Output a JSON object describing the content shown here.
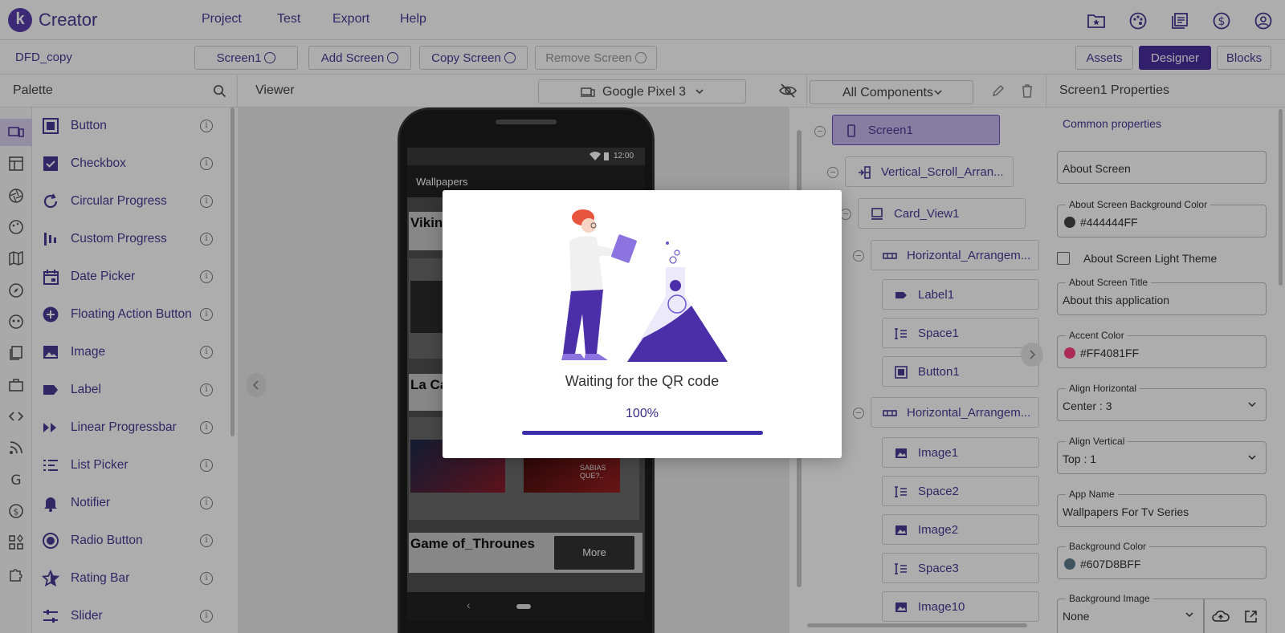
{
  "app": {
    "logo_letter": "k",
    "title": "Creator"
  },
  "menu": [
    "Project",
    "Test",
    "Export",
    "Help"
  ],
  "top_icons": [
    "folder-star-icon",
    "palette-icon",
    "library-icon",
    "dollar-icon",
    "account-icon"
  ],
  "toolbar": {
    "project_name": "DFD_copy",
    "screen_select": "Screen1",
    "add_screen": "Add Screen",
    "copy_screen": "Copy Screen",
    "remove_screen": "Remove Screen",
    "assets": "Assets",
    "designer": "Designer",
    "blocks": "Blocks"
  },
  "palette": {
    "title": "Palette",
    "items": [
      {
        "label": "Button",
        "icon": "button-icon"
      },
      {
        "label": "Checkbox",
        "icon": "checkbox-icon"
      },
      {
        "label": "Circular Progress",
        "icon": "circular-progress-icon"
      },
      {
        "label": "Custom Progress",
        "icon": "custom-progress-icon"
      },
      {
        "label": "Date Picker",
        "icon": "date-picker-icon"
      },
      {
        "label": "Floating Action Button",
        "icon": "fab-icon"
      },
      {
        "label": "Image",
        "icon": "image-icon"
      },
      {
        "label": "Label",
        "icon": "label-icon"
      },
      {
        "label": "Linear Progressbar",
        "icon": "linear-progress-icon"
      },
      {
        "label": "List Picker",
        "icon": "list-picker-icon"
      },
      {
        "label": "Notifier",
        "icon": "bell-icon"
      },
      {
        "label": "Radio Button",
        "icon": "radio-icon"
      },
      {
        "label": "Rating Bar",
        "icon": "star-icon"
      },
      {
        "label": "Slider",
        "icon": "slider-icon"
      }
    ],
    "info_glyph": "i"
  },
  "viewer": {
    "title": "Viewer",
    "device": "Google Pixel 3",
    "phone": {
      "time": "12:00",
      "app_title": "Wallpapers",
      "card1_title": "Vikin",
      "card2_title": "La Ca",
      "card3_title": "Game of_Throunes",
      "more_button": "More",
      "thumb_text": "SABIAS QUE?..",
      "nav_back": "‹"
    }
  },
  "components": {
    "select": "All Components",
    "nodes": [
      {
        "label": "Screen1",
        "icon": "phone-icon"
      },
      {
        "label": "Vertical_Scroll_Arran...",
        "icon": "vertical-scroll-icon"
      },
      {
        "label": "Card_View1",
        "icon": "card-icon"
      },
      {
        "label": "Horizontal_Arrangem...",
        "icon": "horizontal-arrangement-icon"
      },
      {
        "label": "Label1",
        "icon": "label-icon"
      },
      {
        "label": "Space1",
        "icon": "space-icon"
      },
      {
        "label": "Button1",
        "icon": "button-icon"
      },
      {
        "label": "Horizontal_Arrangem...",
        "icon": "horizontal-arrangement-icon"
      },
      {
        "label": "Image1",
        "icon": "image-icon"
      },
      {
        "label": "Space2",
        "icon": "space-icon"
      },
      {
        "label": "Image2",
        "icon": "image-icon"
      },
      {
        "label": "Space3",
        "icon": "space-icon"
      },
      {
        "label": "Image10",
        "icon": "image-icon"
      }
    ]
  },
  "properties": {
    "title": "Screen1 Properties",
    "section": "Common properties",
    "about_screen_placeholder": "About Screen",
    "bg_color_label": "About Screen Background Color",
    "bg_color_value": "#444444FF",
    "light_theme_label": "About Screen Light Theme",
    "title_label": "About Screen Title",
    "title_value": "About this application",
    "accent_label": "Accent Color",
    "accent_value": "#FF4081FF",
    "align_h_label": "Align Horizontal",
    "align_h_value": "Center : 3",
    "align_v_label": "Align Vertical",
    "align_v_value": "Top : 1",
    "app_name_label": "App Name",
    "app_name_value": "Wallpapers For Tv Series",
    "background_color_label": "Background Color",
    "background_color_value": "#607D8BFF",
    "background_image_label": "Background Image",
    "background_image_value": "None"
  },
  "modal": {
    "message": "Waiting for the QR code",
    "percent_text": "100%",
    "progress": 1.0
  },
  "colors": {
    "accent": "#4a2fa0",
    "swatch_about": "#444444",
    "swatch_accent": "#FF4081",
    "swatch_bg": "#607D8B"
  }
}
